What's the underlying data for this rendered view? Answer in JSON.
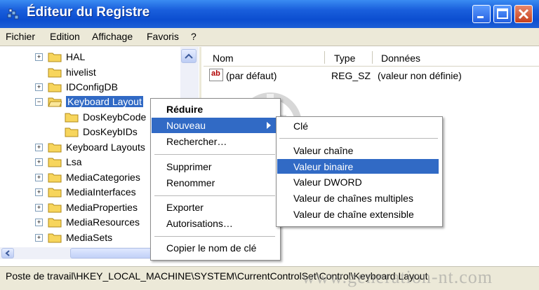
{
  "window": {
    "title": "Éditeur du Registre"
  },
  "menubar": [
    "Fichier",
    "Edition",
    "Affichage",
    "Favoris",
    "?"
  ],
  "tree": [
    {
      "label": "HAL",
      "expander": "+"
    },
    {
      "label": "hivelist",
      "expander": ""
    },
    {
      "label": "IDConfigDB",
      "expander": "+"
    },
    {
      "label": "Keyboard Layout",
      "expander": "−"
    },
    {
      "label": "DosKeybCode",
      "expander": ""
    },
    {
      "label": "DosKeybIDs",
      "expander": ""
    },
    {
      "label": "Keyboard Layouts",
      "expander": "+"
    },
    {
      "label": "Lsa",
      "expander": "+"
    },
    {
      "label": "MediaCategories",
      "expander": "+"
    },
    {
      "label": "MediaInterfaces",
      "expander": "+"
    },
    {
      "label": "MediaProperties",
      "expander": "+"
    },
    {
      "label": "MediaResources",
      "expander": "+"
    },
    {
      "label": "MediaSets",
      "expander": "+"
    }
  ],
  "list": {
    "columns": [
      "Nom",
      "Type",
      "Données"
    ],
    "rows": [
      {
        "name": "(par défaut)",
        "type": "REG_SZ",
        "data": "(valeur non définie)"
      }
    ],
    "value_icon_text": "ab"
  },
  "context_menu": {
    "items": [
      "Réduire",
      "Nouveau",
      "Rechercher…",
      "Supprimer",
      "Renommer",
      "Exporter",
      "Autorisations…",
      "Copier le nom de clé"
    ]
  },
  "submenu": {
    "items": [
      "Clé",
      "Valeur chaîne",
      "Valeur binaire",
      "Valeur DWORD",
      "Valeur de chaînes multiples",
      "Valeur de chaîne extensible"
    ]
  },
  "statusbar": {
    "path": "Poste de travail\\HKEY_LOCAL_MACHINE\\SYSTEM\\CurrentControlSet\\Control\\Keyboard Layout"
  },
  "watermark": "www.generation-nt.com",
  "colors": {
    "titlebar": "#0c4ed0",
    "selection": "#316ac5",
    "chrome": "#ece9d8"
  }
}
